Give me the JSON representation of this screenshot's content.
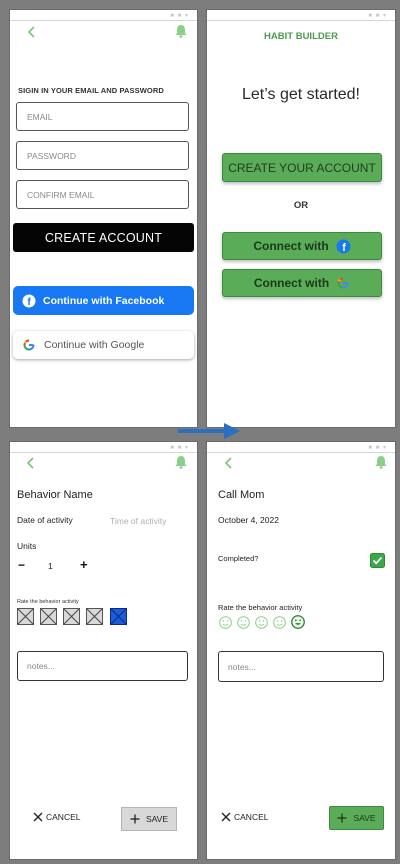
{
  "colors": {
    "brand_green": "#5aac58",
    "green_text": "#4e9a4c",
    "facebook_blue": "#1877f2",
    "selected_blue": "#1e5bd8"
  },
  "screen_signin": {
    "heading": "SIGIN IN YOUR EMAIL AND PASSWORD",
    "email_placeholder": "EMAIL",
    "password_placeholder": "PASSWORD",
    "confirm_placeholder": "CONFIRM EMAIL",
    "create_account": "CREATE ACCOUNT",
    "facebook_label": "Continue with Facebook",
    "google_label": "Continue with Google"
  },
  "screen_start": {
    "app_title": "HABIT BUILDER",
    "headline": "Let’s get started!",
    "create_button": "CREATE YOUR ACCOUNT",
    "or_label": "OR",
    "connect_facebook": "Connect with",
    "connect_google": "Connect with"
  },
  "screen_behavior": {
    "title": "Behavior Name",
    "date_label": "Date of activity",
    "time_placeholder": "Time of activity",
    "units_label": "Units",
    "minus": "−",
    "units_value": "1",
    "plus": "+",
    "rate_label": "Rate the behavior activity",
    "selected_rating": 5,
    "notes_placeholder": "notes...",
    "cancel_label": "CANCEL",
    "save_label": "SAVE"
  },
  "screen_callmom": {
    "title": "Call Mom",
    "date": "October 4, 2022",
    "completed_label": "Completed?",
    "completed": true,
    "rate_label": "Rate the behavior activity",
    "selected_rating": 5,
    "notes_placeholder": "notes...",
    "cancel_label": "CANCEL",
    "save_label": "SAVE"
  },
  "icons": {
    "back": "chevron-left-icon",
    "bell": "bell-icon",
    "arrow": "arrow-right-icon"
  }
}
